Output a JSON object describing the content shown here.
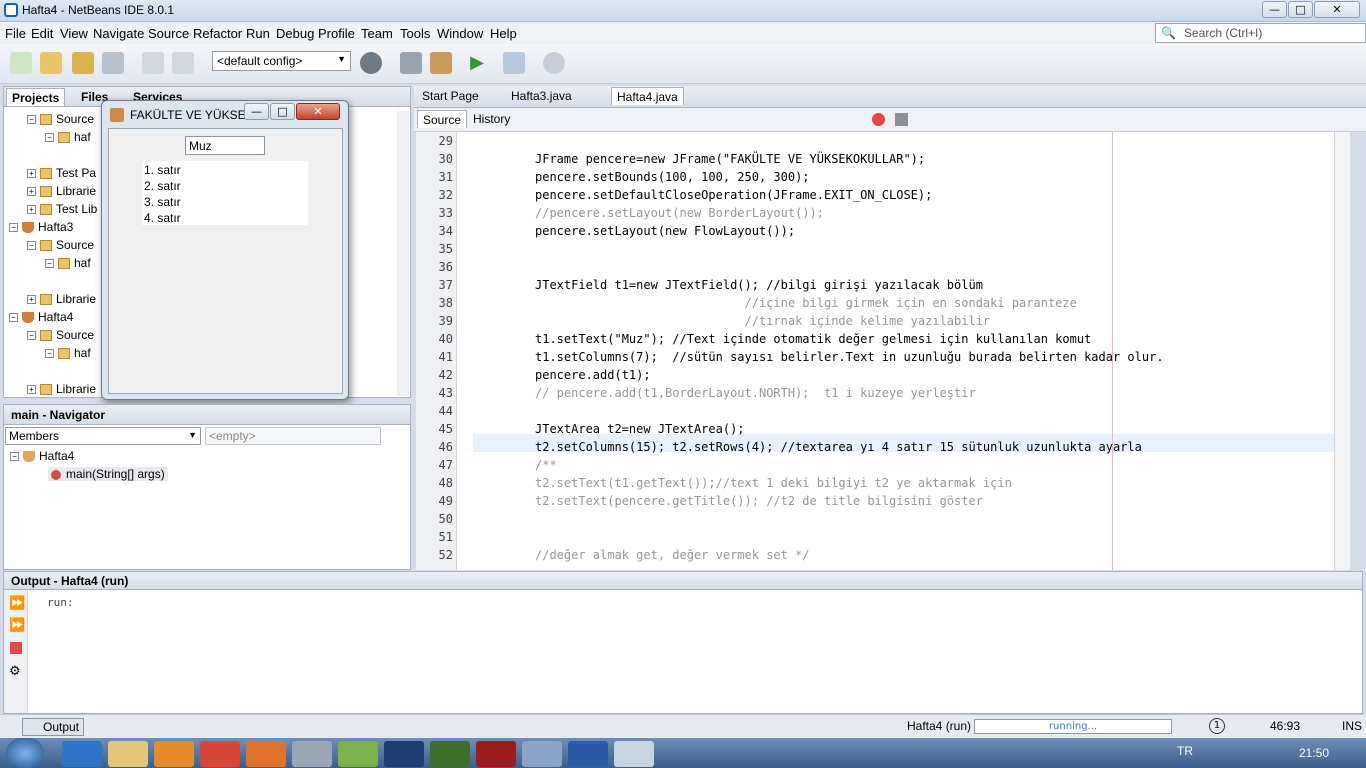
{
  "window": {
    "title": "Hafta4 - NetBeans IDE 8.0.1"
  },
  "menu": [
    "File",
    "Edit",
    "View",
    "Navigate",
    "Source",
    "Refactor",
    "Run",
    "Debug",
    "Profile",
    "Team",
    "Tools",
    "Window",
    "Help"
  ],
  "search": {
    "placeholder": "Search (Ctrl+I)"
  },
  "toolbar": {
    "config": "<default config>"
  },
  "projects": {
    "tabs": [
      "Projects",
      "Files",
      "Services"
    ],
    "tree": [
      "Source",
      "haf",
      "Test Pa",
      "Librarie",
      "Test Lib",
      "Hafta3",
      "Source",
      "haf",
      "Librarie",
      "Hafta4",
      "Source",
      "haf",
      "Librarie"
    ]
  },
  "floating_window": {
    "title": "FAKÜLTE VE YÜKSE...",
    "textfield": "Muz",
    "textarea_lines": [
      "1. satır",
      "2. satır",
      "3. satır",
      "4. satır"
    ]
  },
  "editor": {
    "tabs": [
      "Start Page",
      "Hafta3.java",
      "Hafta4.java"
    ],
    "subtabs": [
      "Source",
      "History"
    ],
    "lines": [
      {
        "n": "29",
        "t": ""
      },
      {
        "n": "30",
        "t": "JFrame pencere=new JFrame(\"FAKÜLTE VE YÜKSEKOKULLAR\");"
      },
      {
        "n": "31",
        "t": "pencere.setBounds(100, 100, 250, 300);"
      },
      {
        "n": "32",
        "t": "pencere.setDefaultCloseOperation(JFrame.EXIT_ON_CLOSE);"
      },
      {
        "n": "33",
        "t": "//pencere.setLayout(new BorderLayout());"
      },
      {
        "n": "34",
        "t": "pencere.setLayout(new FlowLayout());"
      },
      {
        "n": "35",
        "t": ""
      },
      {
        "n": "36",
        "t": ""
      },
      {
        "n": "37",
        "t": "JTextField t1=new JTextField(); //bilgi girişi yazılacak bölüm"
      },
      {
        "n": "38",
        "t": "                             //içine bilgi girmek için en sondaki paranteze"
      },
      {
        "n": "39",
        "t": "                             //tırnak içinde kelime yazılabilir"
      },
      {
        "n": "40",
        "t": "t1.setText(\"Muz\"); //Text içinde otomatik değer gelmesi için kullanılan komut"
      },
      {
        "n": "41",
        "t": "t1.setColumns(7);  //sütün sayısı belirler.Text in uzunluğu burada belirten kadar olur."
      },
      {
        "n": "42",
        "t": "pencere.add(t1);"
      },
      {
        "n": "43",
        "t": "// pencere.add(t1,BorderLayout.NORTH);  t1 i kuzeye yerleştir"
      },
      {
        "n": "44",
        "t": ""
      },
      {
        "n": "45",
        "t": "JTextArea t2=new JTextArea();"
      },
      {
        "n": "46",
        "t": "t2.setColumns(15); t2.setRows(4); //textarea yı 4 satır 15 sütunluk uzunlukta ayarla"
      },
      {
        "n": "47",
        "t": "/**"
      },
      {
        "n": "48",
        "t": "t2.setText(t1.getText());//text 1 deki bilgiyi t2 ye aktarmak için"
      },
      {
        "n": "49",
        "t": "t2.setText(pencere.getTitle()); //t2 de title bilgisini göster"
      },
      {
        "n": "50",
        "t": ""
      },
      {
        "n": "51",
        "t": ""
      },
      {
        "n": "52",
        "t": "//değer almak get, değer vermek set */"
      }
    ]
  },
  "navigator": {
    "title": "main - Navigator",
    "members": "Members",
    "empty": "<empty>",
    "class": "Hafta4",
    "method": "main(String[] args)"
  },
  "output": {
    "title": "Output - Hafta4 (run)",
    "text": "run:",
    "tab": "Output"
  },
  "status": {
    "task": "Hafta4 (run)",
    "progress": "running...",
    "badge": "1",
    "pos": "46:93",
    "mode": "INS"
  },
  "taskbar": {
    "lang": "TR",
    "time": "21:50"
  }
}
